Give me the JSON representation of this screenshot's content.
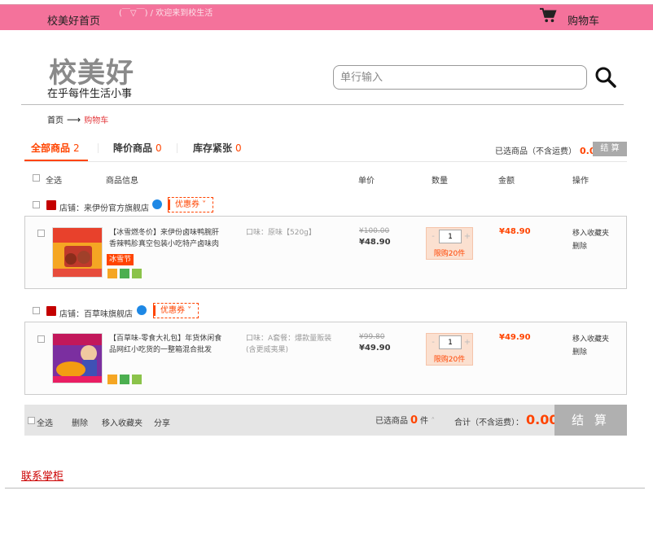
{
  "topbar": {
    "home": "校美好首页",
    "welcome": "(￣▽￣) / 欢迎来到校生活",
    "cart": "购物车",
    "cart_icon": "shopping-cart-icon",
    "background": "#f4729b"
  },
  "header": {
    "logo": "校美好",
    "slogan": "在乎每件生活小事",
    "search_placeholder": "单行输入",
    "search_icon": "search-icon"
  },
  "breadcrumb": {
    "home": "首页",
    "arrow": "⟶",
    "current": "购物车"
  },
  "tabs": [
    {
      "label": "全部商品",
      "count": "2",
      "active": true
    },
    {
      "label": "降价商品",
      "count": "0",
      "active": false
    },
    {
      "label": "库存紧张",
      "count": "0",
      "active": false
    }
  ],
  "summary_top": {
    "selected_label": "已选商品（不含运费）",
    "amount": "0.00",
    "checkout": "结 算"
  },
  "table_header": {
    "select_all": "全选",
    "info": "商品信息",
    "price": "单价",
    "qty": "数量",
    "amount": "金额",
    "ops": "操作"
  },
  "shops": [
    {
      "name": "店铺：来伊份官方旗舰店",
      "coupon": "优惠券",
      "item": {
        "title": "【冰雪燃冬价】来伊份卤味鸭腕肝香辣鸭胗真空包装小吃特产卤味肉",
        "promo": "冰雪节",
        "prop": "口味：原味【520g】",
        "old_price": "¥100.00",
        "new_price": "¥48.90",
        "qty": "1",
        "limit": "限购20件",
        "sum": "¥48.90",
        "op_fav": "移入收藏夹",
        "op_del": "删除"
      }
    },
    {
      "name": "店铺：百草味旗舰店",
      "coupon": "优惠券",
      "item": {
        "title": "【百草味-零食大礼包】年货休闲食品网红小吃货的一整箱混合批发",
        "promo": "",
        "prop": "口味：A套餐：爆款量贩装(含更威夷果)",
        "old_price": "¥99.80",
        "new_price": "¥49.90",
        "qty": "1",
        "limit": "限购20件",
        "sum": "¥49.90",
        "op_fav": "移入收藏夹",
        "op_del": "删除"
      }
    }
  ],
  "footer_bar": {
    "select_all": "全选",
    "delete": "删除",
    "move_fav": "移入收藏夹",
    "share": "分享",
    "selected_prefix": "已选商品",
    "selected_count": "0",
    "selected_suffix": "件",
    "total_label": "合计（不含运费）：",
    "total": "0.00",
    "checkout": "结 算"
  },
  "contact": "联系掌柜",
  "colors": {
    "accent": "#ff4400",
    "topbar": "#f4729b",
    "checkout_disabled": "#b0b0b0"
  }
}
